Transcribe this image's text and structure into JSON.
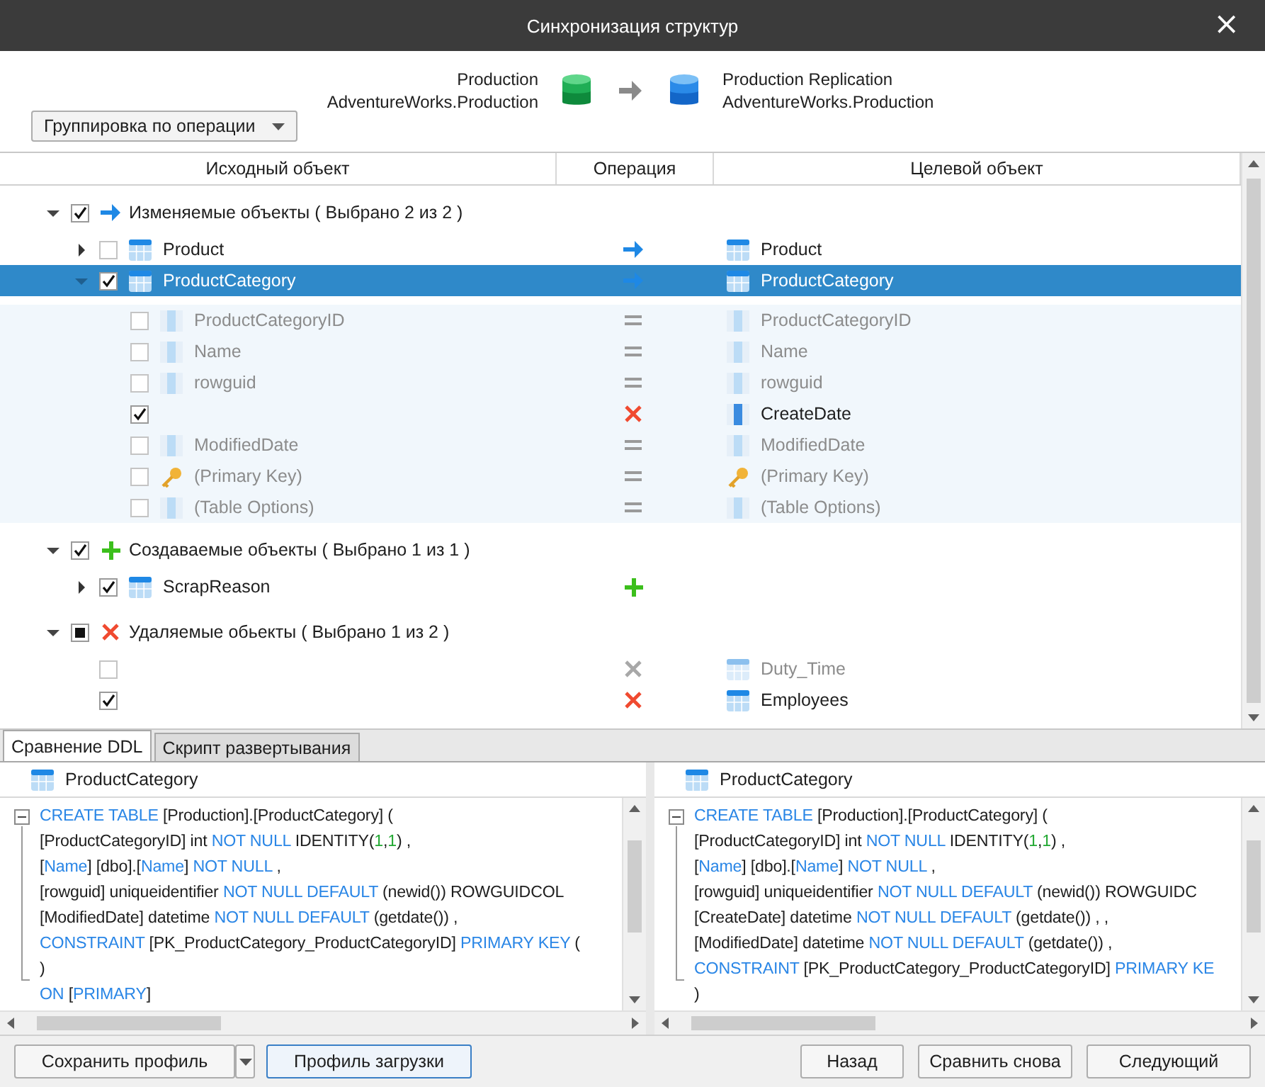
{
  "window": {
    "title": "Синхронизация структур",
    "close": "×"
  },
  "source": {
    "server": "Production",
    "database": "AdventureWorks.Production"
  },
  "target": {
    "server": "Production Replication",
    "database": "AdventureWorks.Production"
  },
  "grouping": {
    "value": "Группировка по операции"
  },
  "columns": [
    "Исходный объект",
    "Операция",
    "Целевой объект"
  ],
  "groups": [
    {
      "label": "Изменяемые объекты ( Выбрано 2 из 2 )",
      "checked": true,
      "partial": false,
      "operation": {
        "kind": "modify"
      },
      "expanded": true,
      "items": [
        {
          "source": "Product",
          "target": "Product",
          "kind": "table",
          "operation": {
            "kind": "modify"
          },
          "checked": false,
          "expanded": false,
          "selected": false,
          "dimmed": false
        },
        {
          "source": "ProductCategory",
          "target": "ProductCategory",
          "kind": "table",
          "operation": {
            "kind": "modify"
          },
          "checked": true,
          "expanded": true,
          "selected": true,
          "dimmed": false,
          "children": [
            {
              "source": "ProductCategoryID",
              "target": "ProductCategoryID",
              "kind": "column",
              "operation": {
                "kind": "equal"
              },
              "checked": false,
              "dimmed": true
            },
            {
              "source": "Name",
              "target": "Name",
              "kind": "column",
              "operation": {
                "kind": "equal"
              },
              "checked": false,
              "dimmed": true
            },
            {
              "source": "rowguid",
              "target": "rowguid",
              "kind": "column",
              "operation": {
                "kind": "equal"
              },
              "checked": false,
              "dimmed": true
            },
            {
              "target": "CreateDate",
              "kind": "altered",
              "operation": {
                "kind": "delete"
              },
              "checked": true,
              "dimmed": false
            },
            {
              "source": "ModifiedDate",
              "target": "ModifiedDate",
              "kind": "column",
              "operation": {
                "kind": "equal"
              },
              "checked": false,
              "dimmed": true
            },
            {
              "source": "(Primary Key)",
              "target": "(Primary Key)",
              "kind": "key",
              "operation": {
                "kind": "equal"
              },
              "checked": false,
              "dimmed": true
            },
            {
              "source": "(Table Options)",
              "target": "(Table Options)",
              "kind": "column",
              "operation": {
                "kind": "equal"
              },
              "checked": false,
              "dimmed": true
            }
          ]
        }
      ]
    },
    {
      "label": "Создаваемые объекты ( Выбрано 1 из 1 )",
      "checked": true,
      "partial": false,
      "operation": {
        "kind": "create"
      },
      "expanded": true,
      "items": [
        {
          "source": "ScrapReason",
          "kind": "table",
          "operation": {
            "kind": "create"
          },
          "checked": true,
          "expanded": false,
          "selected": false,
          "dimmed": false
        }
      ]
    },
    {
      "label": "Удаляемые обьекты ( Выбрано 1 из 2 )",
      "checked": false,
      "partial": true,
      "operation": {
        "kind": "delete"
      },
      "expanded": true,
      "items": [
        {
          "target": "Duty_Time",
          "kind": "table",
          "operation": {
            "kind": "delete"
          },
          "checked": false,
          "selected": false,
          "dimmed": true
        },
        {
          "target": "Employees",
          "kind": "table",
          "operation": {
            "kind": "delete"
          },
          "checked": true,
          "selected": false,
          "dimmed": false
        }
      ]
    }
  ],
  "tabs": [
    {
      "label": "Сравнение DDL",
      "selected": true
    },
    {
      "label": "Скрипт развертывания",
      "selected": false
    }
  ],
  "ddl": [
    {
      "object": "ProductCategory",
      "lines": [
        [
          {
            "kind": "keyword",
            "text": "CREATE TABLE"
          },
          {
            "kind": "plain",
            "text": " [Production].[ProductCategory] ("
          }
        ],
        [
          {
            "kind": "plain",
            "text": "[ProductCategoryID] int "
          },
          {
            "kind": "keyword",
            "text": "NOT NULL"
          },
          {
            "kind": "plain",
            "text": " IDENTITY("
          },
          {
            "kind": "number",
            "text": "1"
          },
          {
            "kind": "plain",
            "text": ","
          },
          {
            "kind": "number",
            "text": "1"
          },
          {
            "kind": "plain",
            "text": ") ,"
          }
        ],
        [
          {
            "kind": "plain",
            "text": "["
          },
          {
            "kind": "keyword",
            "text": "Name"
          },
          {
            "kind": "plain",
            "text": "] [dbo].["
          },
          {
            "kind": "keyword",
            "text": "Name"
          },
          {
            "kind": "plain",
            "text": "] "
          },
          {
            "kind": "keyword",
            "text": "NOT NULL"
          },
          {
            "kind": "plain",
            "text": " ,"
          }
        ],
        [
          {
            "kind": "plain",
            "text": "[rowguid] uniqueidentifier "
          },
          {
            "kind": "keyword",
            "text": "NOT NULL DEFAULT"
          },
          {
            "kind": "plain",
            "text": " (newid()) ROWGUIDCOL"
          }
        ],
        [
          {
            "kind": "plain",
            "text": "[ModifiedDate] datetime "
          },
          {
            "kind": "keyword",
            "text": "NOT NULL DEFAULT"
          },
          {
            "kind": "plain",
            "text": " (getdate()) ,"
          }
        ],
        [
          {
            "kind": "keyword",
            "text": "CONSTRAINT"
          },
          {
            "kind": "plain",
            "text": " [PK_ProductCategory_ProductCategoryID] "
          },
          {
            "kind": "keyword",
            "text": "PRIMARY KEY"
          },
          {
            "kind": "plain",
            "text": " ("
          }
        ],
        [
          {
            "kind": "plain",
            "text": ")"
          }
        ],
        [
          {
            "kind": "keyword",
            "text": "ON"
          },
          {
            "kind": "plain",
            "text": " ["
          },
          {
            "kind": "keyword",
            "text": "PRIMARY"
          },
          {
            "kind": "plain",
            "text": "]"
          }
        ]
      ]
    },
    {
      "object": "ProductCategory",
      "lines": [
        [
          {
            "kind": "keyword",
            "text": "CREATE TABLE"
          },
          {
            "kind": "plain",
            "text": " [Production].[ProductCategory] ("
          }
        ],
        [
          {
            "kind": "plain",
            "text": "[ProductCategoryID] int "
          },
          {
            "kind": "keyword",
            "text": "NOT NULL"
          },
          {
            "kind": "plain",
            "text": " IDENTITY("
          },
          {
            "kind": "number",
            "text": "1"
          },
          {
            "kind": "plain",
            "text": ","
          },
          {
            "kind": "number",
            "text": "1"
          },
          {
            "kind": "plain",
            "text": ") ,"
          }
        ],
        [
          {
            "kind": "plain",
            "text": "["
          },
          {
            "kind": "keyword",
            "text": "Name"
          },
          {
            "kind": "plain",
            "text": "] [dbo].["
          },
          {
            "kind": "keyword",
            "text": "Name"
          },
          {
            "kind": "plain",
            "text": "] "
          },
          {
            "kind": "keyword",
            "text": "NOT NULL"
          },
          {
            "kind": "plain",
            "text": " ,"
          }
        ],
        [
          {
            "kind": "plain",
            "text": "[rowguid] uniqueidentifier "
          },
          {
            "kind": "keyword",
            "text": "NOT NULL DEFAULT"
          },
          {
            "kind": "plain",
            "text": " (newid()) ROWGUIDC"
          }
        ],
        [
          {
            "kind": "plain",
            "text": "[CreateDate] datetime "
          },
          {
            "kind": "keyword",
            "text": "NOT NULL DEFAULT"
          },
          {
            "kind": "plain",
            "text": " (getdate()) , ,"
          }
        ],
        [
          {
            "kind": "plain",
            "text": "[ModifiedDate] datetime "
          },
          {
            "kind": "keyword",
            "text": "NOT NULL DEFAULT"
          },
          {
            "kind": "plain",
            "text": " (getdate()) ,"
          }
        ],
        [
          {
            "kind": "keyword",
            "text": "CONSTRAINT"
          },
          {
            "kind": "plain",
            "text": " [PK_ProductCategory_ProductCategoryID] "
          },
          {
            "kind": "keyword",
            "text": "PRIMARY KE"
          }
        ],
        [
          {
            "kind": "plain",
            "text": ")"
          }
        ]
      ]
    }
  ],
  "buttons": {
    "left": [
      "Сохранить профиль",
      "Профиль загрузки"
    ],
    "right": [
      "Назад",
      "Сравнить снова",
      "Следующий"
    ]
  }
}
